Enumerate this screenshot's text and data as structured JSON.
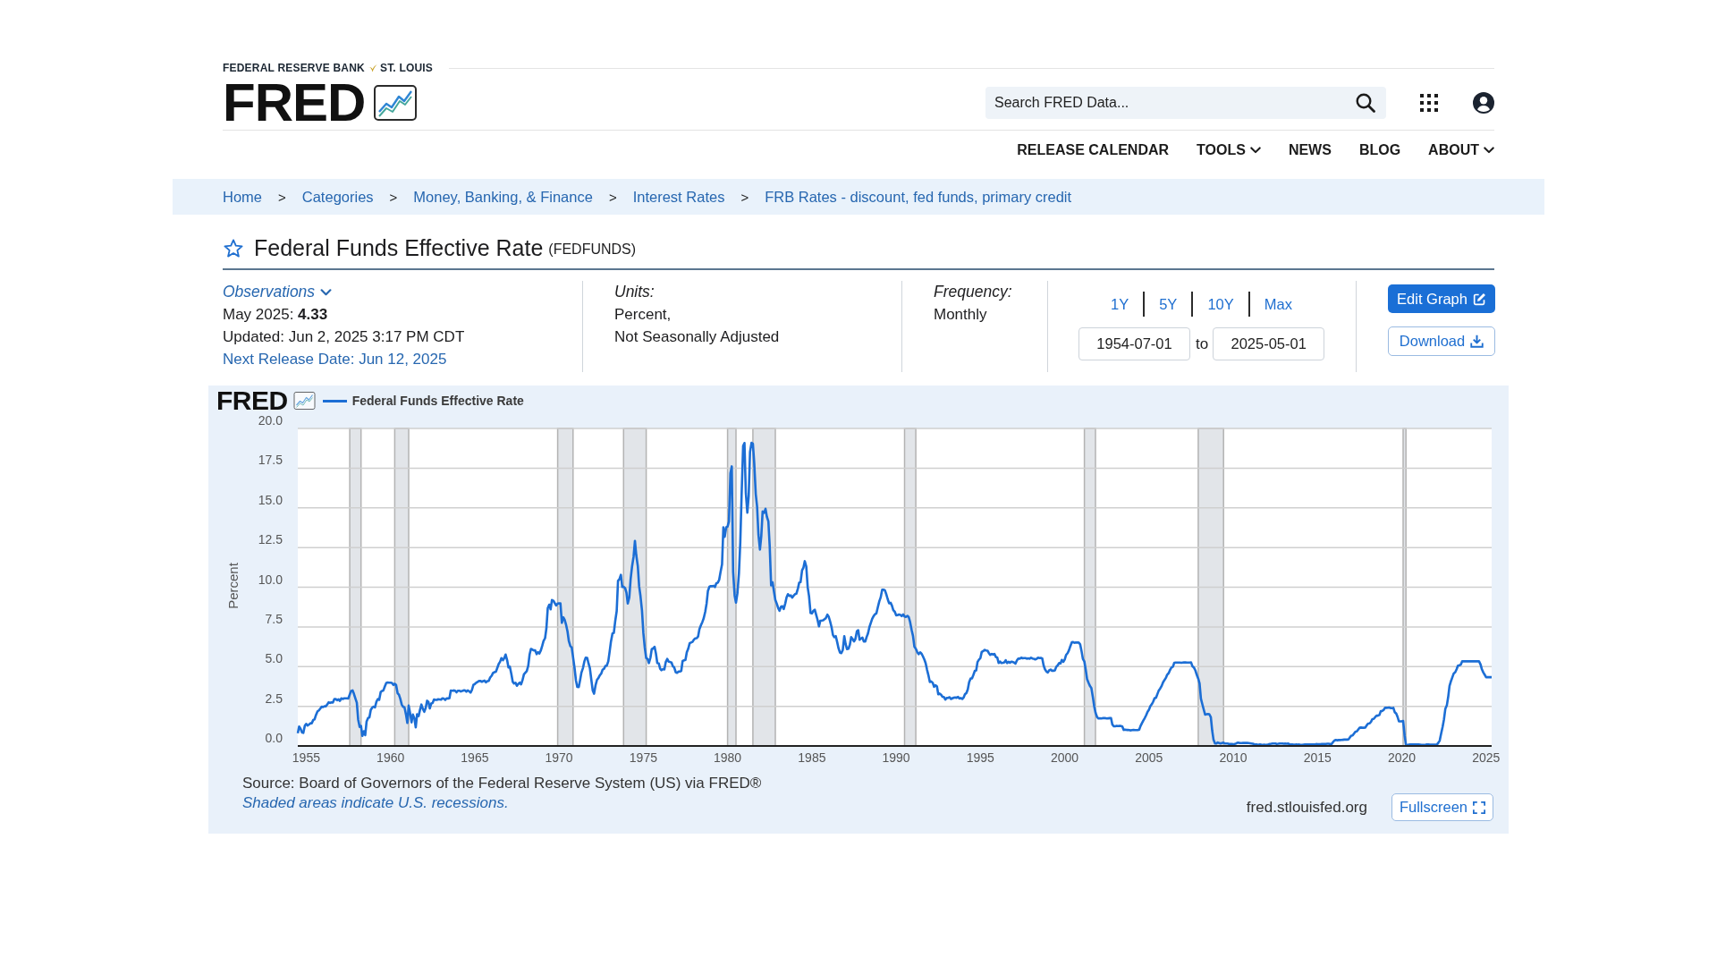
{
  "header": {
    "bank_name": "FEDERAL RESERVE BANK",
    "bank_city": "ST. LOUIS",
    "logo": "FRED",
    "search": {
      "placeholder": "Search FRED Data..."
    }
  },
  "nav": [
    {
      "label": "RELEASE CALENDAR",
      "kind": "link"
    },
    {
      "label": "TOOLS",
      "kind": "menu"
    },
    {
      "label": "NEWS",
      "kind": "link"
    },
    {
      "label": "BLOG",
      "kind": "link"
    },
    {
      "label": "ABOUT",
      "kind": "menu"
    }
  ],
  "breadcrumbs": [
    {
      "kind": "link",
      "text": "Home"
    },
    {
      "kind": "separator",
      "text": ">"
    },
    {
      "kind": "link",
      "text": "Categories"
    },
    {
      "kind": "separator",
      "text": ">"
    },
    {
      "kind": "link",
      "text": "Money, Banking, & Finance"
    },
    {
      "kind": "separator",
      "text": ">"
    },
    {
      "kind": "link",
      "text": "Interest Rates"
    },
    {
      "kind": "separator",
      "text": ">"
    },
    {
      "kind": "link",
      "text": "FRB Rates - discount, fed funds, primary credit"
    }
  ],
  "series": {
    "title": "Federal Funds Effective Rate",
    "code": "(FEDFUNDS)",
    "favorite": false
  },
  "observations": {
    "label": "Observations",
    "latest": "May 2025: **4.33**",
    "updated": "Updated: Jun 2, 2025 3:17 PM CDT",
    "next_release": "Next Release Date: Jun 12, 2025"
  },
  "units": {
    "label": "Units:",
    "lines": [
      "Percent,",
      "Not Seasonally Adjusted"
    ]
  },
  "frequency": {
    "label": "Frequency:",
    "value": "Monthly"
  },
  "date_range": {
    "presets": [
      {
        "label": "1Y",
        "selected": false
      },
      {
        "label": "5Y",
        "selected": false
      },
      {
        "label": "10Y",
        "selected": false
      },
      {
        "label": "Max",
        "selected": false
      }
    ],
    "start": "1954-07-01",
    "separator": "to",
    "end": "2025-05-01"
  },
  "actions": [
    {
      "label": "Edit Graph",
      "kind": "edit"
    },
    {
      "label": "Download",
      "kind": "download"
    }
  ],
  "graph": {
    "logo": "FRED",
    "chart_data": {
      "type": "line",
      "ylabel": "Percent",
      "grid": true,
      "x": [
        1954.5,
        1954.58,
        1954.67,
        1954.75,
        1954.83,
        1954.92,
        1955,
        1955.08,
        1955.17,
        1955.25,
        1955.33,
        1955.42,
        1955.5,
        1955.58,
        1955.67,
        1955.75,
        1955.83,
        1955.92,
        1956,
        1956.08,
        1956.17,
        1956.25,
        1956.33,
        1956.42,
        1956.5,
        1956.58,
        1956.67,
        1956.75,
        1956.83,
        1956.92,
        1957,
        1957.08,
        1957.17,
        1957.25,
        1957.33,
        1957.42,
        1957.5,
        1957.58,
        1957.67,
        1957.75,
        1957.83,
        1957.92,
        1958,
        1958.08,
        1958.17,
        1958.25,
        1958.33,
        1958.42,
        1958.5,
        1958.58,
        1958.67,
        1958.75,
        1958.83,
        1958.92,
        1959,
        1959.08,
        1959.17,
        1959.25,
        1959.33,
        1959.42,
        1959.5,
        1959.58,
        1959.67,
        1959.75,
        1959.83,
        1959.92,
        1960,
        1960.08,
        1960.17,
        1960.25,
        1960.33,
        1960.42,
        1960.5,
        1960.58,
        1960.67,
        1960.75,
        1960.83,
        1960.92,
        1961,
        1961.08,
        1961.17,
        1961.25,
        1961.33,
        1961.42,
        1961.5,
        1961.58,
        1961.67,
        1961.75,
        1961.83,
        1961.92,
        1962,
        1962.08,
        1962.17,
        1962.25,
        1962.33,
        1962.42,
        1962.5,
        1962.58,
        1962.67,
        1962.75,
        1962.83,
        1962.92,
        1963,
        1963.08,
        1963.17,
        1963.25,
        1963.33,
        1963.42,
        1963.5,
        1963.58,
        1963.67,
        1963.75,
        1963.83,
        1963.92,
        1964,
        1964.08,
        1964.17,
        1964.25,
        1964.33,
        1964.42,
        1964.5,
        1964.58,
        1964.67,
        1964.75,
        1964.83,
        1964.92,
        1965,
        1965.08,
        1965.17,
        1965.25,
        1965.33,
        1965.42,
        1965.5,
        1965.58,
        1965.67,
        1965.75,
        1965.83,
        1965.92,
        1966,
        1966.08,
        1966.17,
        1966.25,
        1966.33,
        1966.42,
        1966.5,
        1966.58,
        1966.67,
        1966.75,
        1966.83,
        1966.92,
        1967,
        1967.08,
        1967.17,
        1967.25,
        1967.33,
        1967.42,
        1967.5,
        1967.58,
        1967.67,
        1967.75,
        1967.83,
        1967.92,
        1968,
        1968.08,
        1968.17,
        1968.25,
        1968.33,
        1968.42,
        1968.5,
        1968.58,
        1968.67,
        1968.75,
        1968.83,
        1968.92,
        1969,
        1969.08,
        1969.17,
        1969.25,
        1969.33,
        1969.42,
        1969.5,
        1969.58,
        1969.67,
        1969.75,
        1969.83,
        1969.92,
        1970,
        1970.08,
        1970.17,
        1970.25,
        1970.33,
        1970.42,
        1970.5,
        1970.58,
        1970.67,
        1970.75,
        1970.83,
        1970.92,
        1971,
        1971.08,
        1971.17,
        1971.25,
        1971.33,
        1971.42,
        1971.5,
        1971.58,
        1971.67,
        1971.75,
        1971.83,
        1971.92,
        1972,
        1972.08,
        1972.17,
        1972.25,
        1972.33,
        1972.42,
        1972.5,
        1972.58,
        1972.67,
        1972.75,
        1972.83,
        1972.92,
        1973,
        1973.08,
        1973.17,
        1973.25,
        1973.33,
        1973.42,
        1973.5,
        1973.58,
        1973.67,
        1973.75,
        1973.83,
        1973.92,
        1974,
        1974.08,
        1974.17,
        1974.25,
        1974.33,
        1974.42,
        1974.5,
        1974.58,
        1974.67,
        1974.75,
        1974.83,
        1974.92,
        1975,
        1975.08,
        1975.17,
        1975.25,
        1975.33,
        1975.42,
        1975.5,
        1975.58,
        1975.67,
        1975.75,
        1975.83,
        1975.92,
        1976,
        1976.08,
        1976.17,
        1976.25,
        1976.33,
        1976.42,
        1976.5,
        1976.58,
        1976.67,
        1976.75,
        1976.83,
        1976.92,
        1977,
        1977.08,
        1977.17,
        1977.25,
        1977.33,
        1977.42,
        1977.5,
        1977.58,
        1977.67,
        1977.75,
        1977.83,
        1977.92,
        1978,
        1978.08,
        1978.17,
        1978.25,
        1978.33,
        1978.42,
        1978.5,
        1978.58,
        1978.67,
        1978.75,
        1978.83,
        1978.92,
        1979,
        1979.08,
        1979.17,
        1979.25,
        1979.33,
        1979.42,
        1979.5,
        1979.58,
        1979.67,
        1979.75,
        1979.83,
        1979.92,
        1980,
        1980.08,
        1980.17,
        1980.25,
        1980.33,
        1980.42,
        1980.5,
        1980.58,
        1980.67,
        1980.75,
        1980.83,
        1980.92,
        1981,
        1981.08,
        1981.17,
        1981.25,
        1981.33,
        1981.42,
        1981.5,
        1981.58,
        1981.67,
        1981.75,
        1981.83,
        1981.92,
        1982,
        1982.08,
        1982.17,
        1982.25,
        1982.33,
        1982.42,
        1982.5,
        1982.58,
        1982.67,
        1982.75,
        1982.83,
        1982.92,
        1983,
        1983.08,
        1983.17,
        1983.25,
        1983.33,
        1983.42,
        1983.5,
        1983.58,
        1983.67,
        1983.75,
        1983.83,
        1983.92,
        1984,
        1984.08,
        1984.17,
        1984.25,
        1984.33,
        1984.42,
        1984.5,
        1984.58,
        1984.67,
        1984.75,
        1984.83,
        1984.92,
        1985,
        1985.08,
        1985.17,
        1985.25,
        1985.33,
        1985.42,
        1985.5,
        1985.58,
        1985.67,
        1985.75,
        1985.83,
        1985.92,
        1986,
        1986.08,
        1986.17,
        1986.25,
        1986.33,
        1986.42,
        1986.5,
        1986.58,
        1986.67,
        1986.75,
        1986.83,
        1986.92,
        1987,
        1987.08,
        1987.17,
        1987.25,
        1987.33,
        1987.42,
        1987.5,
        1987.58,
        1987.67,
        1987.75,
        1987.83,
        1987.92,
        1988,
        1988.08,
        1988.17,
        1988.25,
        1988.33,
        1988.42,
        1988.5,
        1988.58,
        1988.67,
        1988.75,
        1988.83,
        1988.92,
        1989,
        1989.08,
        1989.17,
        1989.25,
        1989.33,
        1989.42,
        1989.5,
        1989.58,
        1989.67,
        1989.75,
        1989.83,
        1989.92,
        1990,
        1990.08,
        1990.17,
        1990.25,
        1990.33,
        1990.42,
        1990.5,
        1990.58,
        1990.67,
        1990.75,
        1990.83,
        1990.92,
        1991,
        1991.08,
        1991.17,
        1991.25,
        1991.33,
        1991.42,
        1991.5,
        1991.58,
        1991.67,
        1991.75,
        1991.83,
        1991.92,
        1992,
        1992.08,
        1992.17,
        1992.25,
        1992.33,
        1992.42,
        1992.5,
        1992.58,
        1992.67,
        1992.75,
        1992.83,
        1992.92,
        1993,
        1993.08,
        1993.17,
        1993.25,
        1993.33,
        1993.42,
        1993.5,
        1993.58,
        1993.67,
        1993.75,
        1993.83,
        1993.92,
        1994,
        1994.08,
        1994.17,
        1994.25,
        1994.33,
        1994.42,
        1994.5,
        1994.58,
        1994.67,
        1994.75,
        1994.83,
        1994.92,
        1995,
        1995.08,
        1995.17,
        1995.25,
        1995.33,
        1995.42,
        1995.5,
        1995.58,
        1995.67,
        1995.75,
        1995.83,
        1995.92,
        1996,
        1996.08,
        1996.17,
        1996.25,
        1996.33,
        1996.42,
        1996.5,
        1996.58,
        1996.67,
        1996.75,
        1996.83,
        1996.92,
        1997,
        1997.08,
        1997.17,
        1997.25,
        1997.33,
        1997.42,
        1997.5,
        1997.58,
        1997.67,
        1997.75,
        1997.83,
        1997.92,
        1998,
        1998.08,
        1998.17,
        1998.25,
        1998.33,
        1998.42,
        1998.5,
        1998.58,
        1998.67,
        1998.75,
        1998.83,
        1998.92,
        1999,
        1999.08,
        1999.17,
        1999.25,
        1999.33,
        1999.42,
        1999.5,
        1999.58,
        1999.67,
        1999.75,
        1999.83,
        1999.92,
        2000,
        2000.08,
        2000.17,
        2000.25,
        2000.33,
        2000.42,
        2000.5,
        2000.58,
        2000.67,
        2000.75,
        2000.83,
        2000.92,
        2001,
        2001.08,
        2001.17,
        2001.25,
        2001.33,
        2001.42,
        2001.5,
        2001.58,
        2001.67,
        2001.75,
        2001.83,
        2001.92,
        2002,
        2002.08,
        2002.17,
        2002.25,
        2002.33,
        2002.42,
        2002.5,
        2002.58,
        2002.67,
        2002.75,
        2002.83,
        2002.92,
        2003,
        2003.08,
        2003.17,
        2003.25,
        2003.33,
        2003.42,
        2003.5,
        2003.58,
        2003.67,
        2003.75,
        2003.83,
        2003.92,
        2004,
        2004.08,
        2004.17,
        2004.25,
        2004.33,
        2004.42,
        2004.5,
        2004.58,
        2004.67,
        2004.75,
        2004.83,
        2004.92,
        2005,
        2005.08,
        2005.17,
        2005.25,
        2005.33,
        2005.42,
        2005.5,
        2005.58,
        2005.67,
        2005.75,
        2005.83,
        2005.92,
        2006,
        2006.08,
        2006.17,
        2006.25,
        2006.33,
        2006.42,
        2006.5,
        2006.58,
        2006.67,
        2006.75,
        2006.83,
        2006.92,
        2007,
        2007.08,
        2007.17,
        2007.25,
        2007.33,
        2007.42,
        2007.5,
        2007.58,
        2007.67,
        2007.75,
        2007.83,
        2007.92,
        2008,
        2008.08,
        2008.17,
        2008.25,
        2008.33,
        2008.42,
        2008.5,
        2008.58,
        2008.67,
        2008.75,
        2008.83,
        2008.92,
        2009,
        2009.08,
        2009.17,
        2009.25,
        2009.33,
        2009.42,
        2009.5,
        2009.58,
        2009.67,
        2009.75,
        2009.83,
        2009.92,
        2010,
        2010.08,
        2010.17,
        2010.25,
        2010.33,
        2010.42,
        2010.5,
        2010.58,
        2010.67,
        2010.75,
        2010.83,
        2010.92,
        2011,
        2011.08,
        2011.17,
        2011.25,
        2011.33,
        2011.42,
        2011.5,
        2011.58,
        2011.67,
        2011.75,
        2011.83,
        2011.92,
        2012,
        2012.08,
        2012.17,
        2012.25,
        2012.33,
        2012.42,
        2012.5,
        2012.58,
        2012.67,
        2012.75,
        2012.83,
        2012.92,
        2013,
        2013.08,
        2013.17,
        2013.25,
        2013.33,
        2013.42,
        2013.5,
        2013.58,
        2013.67,
        2013.75,
        2013.83,
        2013.92,
        2014,
        2014.08,
        2014.17,
        2014.25,
        2014.33,
        2014.42,
        2014.5,
        2014.58,
        2014.67,
        2014.75,
        2014.83,
        2014.92,
        2015,
        2015.08,
        2015.17,
        2015.25,
        2015.33,
        2015.42,
        2015.5,
        2015.58,
        2015.67,
        2015.75,
        2015.83,
        2015.92,
        2016,
        2016.08,
        2016.17,
        2016.25,
        2016.33,
        2016.42,
        2016.5,
        2016.58,
        2016.67,
        2016.75,
        2016.83,
        2016.92,
        2017,
        2017.08,
        2017.17,
        2017.25,
        2017.33,
        2017.42,
        2017.5,
        2017.58,
        2017.67,
        2017.75,
        2017.83,
        2017.92,
        2018,
        2018.08,
        2018.17,
        2018.25,
        2018.33,
        2018.42,
        2018.5,
        2018.58,
        2018.67,
        2018.75,
        2018.83,
        2018.92,
        2019,
        2019.08,
        2019.17,
        2019.25,
        2019.33,
        2019.42,
        2019.5,
        2019.58,
        2019.67,
        2019.75,
        2019.83,
        2019.92,
        2020,
        2020.08,
        2020.17,
        2020.25,
        2020.33,
        2020.42,
        2020.5,
        2020.58,
        2020.67,
        2020.75,
        2020.83,
        2020.92,
        2021,
        2021.08,
        2021.17,
        2021.25,
        2021.33,
        2021.42,
        2021.5,
        2021.58,
        2021.67,
        2021.75,
        2021.83,
        2021.92,
        2022,
        2022.08,
        2022.17,
        2022.25,
        2022.33,
        2022.42,
        2022.5,
        2022.58,
        2022.67,
        2022.75,
        2022.83,
        2022.92,
        2023,
        2023.08,
        2023.17,
        2023.25,
        2023.33,
        2023.42,
        2023.5,
        2023.58,
        2023.67,
        2023.75,
        2023.83,
        2023.92,
        2024,
        2024.08,
        2024.17,
        2024.25,
        2024.33,
        2024.42,
        2024.5,
        2024.58,
        2024.67,
        2024.75,
        2024.83,
        2024.92,
        2025,
        2025.08,
        2025.17,
        2025.25,
        2025.33
      ],
      "series": [
        {
          "name": "Federal Funds Effective Rate",
          "color": "#1c6ed5",
          "values": [
            0.8,
            1.22,
            1.07,
            0.85,
            0.83,
            1.28,
            1.39,
            1.29,
            1.35,
            1.43,
            1.43,
            1.64,
            1.68,
            1.96,
            2.18,
            2.24,
            2.35,
            2.48,
            2.45,
            2.5,
            2.5,
            2.62,
            2.75,
            2.71,
            2.75,
            2.73,
            2.95,
            2.96,
            2.88,
            2.94,
            2.84,
            3.0,
            2.96,
            3.0,
            3.0,
            3.0,
            2.99,
            3.24,
            3.47,
            3.5,
            3.28,
            2.98,
            2.72,
            1.67,
            1.2,
            1.26,
            0.63,
            0.93,
            0.68,
            1.53,
            1.76,
            1.8,
            2.27,
            2.42,
            2.48,
            2.43,
            2.8,
            2.96,
            2.9,
            3.39,
            3.47,
            3.5,
            3.76,
            3.98,
            4.0,
            3.99,
            3.99,
            3.97,
            3.84,
            3.92,
            3.85,
            3.32,
            3.23,
            2.98,
            2.6,
            2.47,
            2.44,
            1.98,
            1.45,
            2.54,
            2.02,
            1.49,
            1.98,
            1.73,
            1.17,
            2.0,
            1.88,
            2.26,
            2.61,
            2.33,
            2.15,
            2.37,
            2.85,
            2.78,
            2.36,
            2.68,
            2.71,
            2.93,
            2.9,
            2.9,
            2.94,
            2.93,
            2.92,
            3.0,
            2.98,
            2.9,
            3.0,
            2.99,
            3.02,
            3.49,
            3.48,
            3.5,
            3.48,
            3.38,
            3.48,
            3.48,
            3.43,
            3.47,
            3.5,
            3.5,
            3.42,
            3.5,
            3.45,
            3.36,
            3.52,
            3.85,
            3.9,
            3.98,
            4.04,
            4.09,
            4.1,
            4.04,
            4.09,
            4.12,
            4.01,
            4.08,
            4.1,
            4.32,
            4.42,
            4.6,
            4.65,
            4.67,
            4.9,
            5.17,
            5.3,
            5.53,
            5.4,
            5.53,
            5.76,
            5.4,
            4.94,
            5.0,
            4.53,
            4.05,
            3.94,
            3.98,
            3.79,
            3.9,
            3.99,
            3.88,
            4.13,
            4.51,
            4.61,
            4.71,
            5.05,
            5.76,
            6.11,
            6.07,
            6.02,
            6.03,
            5.78,
            5.91,
            5.82,
            6.02,
            6.3,
            6.61,
            6.79,
            7.41,
            8.67,
            8.9,
            8.61,
            9.19,
            9.15,
            9.0,
            8.85,
            8.97,
            8.98,
            8.98,
            7.76,
            8.1,
            7.95,
            7.61,
            7.21,
            6.61,
            6.29,
            6.2,
            5.6,
            4.9,
            4.14,
            3.72,
            3.71,
            4.16,
            4.63,
            4.91,
            5.31,
            5.56,
            5.55,
            5.2,
            4.91,
            4.14,
            3.5,
            3.29,
            3.83,
            4.17,
            4.27,
            4.46,
            4.55,
            4.8,
            4.87,
            5.04,
            5.06,
            5.33,
            5.94,
            6.58,
            7.09,
            7.12,
            7.84,
            8.49,
            10.4,
            10.5,
            10.78,
            10.01,
            10.03,
            9.95,
            9.65,
            8.97,
            9.35,
            10.51,
            11.31,
            11.93,
            12.92,
            12.01,
            11.34,
            10.06,
            9.45,
            8.53,
            7.13,
            6.24,
            5.54,
            5.49,
            5.22,
            5.55,
            6.1,
            6.14,
            6.24,
            5.82,
            5.22,
            5.2,
            4.87,
            4.77,
            4.84,
            4.82,
            5.29,
            5.48,
            5.31,
            5.29,
            5.25,
            5.02,
            4.95,
            4.65,
            4.61,
            4.68,
            4.69,
            4.73,
            5.35,
            5.39,
            5.42,
            5.9,
            6.14,
            6.47,
            6.51,
            6.56,
            6.7,
            6.78,
            6.79,
            6.89,
            7.36,
            7.6,
            7.81,
            8.04,
            8.45,
            8.96,
            9.76,
            10.03,
            10.07,
            10.06,
            10.09,
            10.01,
            10.24,
            10.29,
            10.47,
            10.94,
            11.43,
            13.77,
            13.18,
            13.78,
            13.82,
            14.13,
            17.19,
            17.61,
            10.98,
            9.47,
            9.03,
            9.61,
            10.87,
            12.81,
            15.85,
            18.9,
            19.08,
            15.93,
            14.7,
            15.72,
            18.52,
            19.1,
            19.04,
            17.82,
            15.87,
            15.08,
            13.31,
            12.37,
            13.22,
            14.78,
            14.68,
            14.94,
            14.45,
            14.15,
            12.59,
            10.12,
            10.31,
            9.71,
            9.2,
            8.95,
            8.68,
            8.51,
            8.77,
            8.8,
            8.63,
            8.98,
            9.37,
            9.56,
            9.45,
            9.48,
            9.34,
            9.47,
            9.56,
            9.59,
            9.91,
            10.29,
            10.32,
            11.06,
            11.23,
            11.64,
            11.3,
            9.99,
            9.43,
            8.38,
            8.35,
            8.5,
            8.58,
            8.27,
            7.97,
            7.53,
            7.88,
            7.9,
            7.92,
            7.99,
            8.05,
            8.27,
            8.14,
            7.86,
            7.48,
            6.99,
            6.85,
            6.92,
            6.56,
            6.17,
            5.89,
            5.85,
            6.04,
            6.91,
            6.43,
            6.1,
            6.13,
            6.37,
            6.85,
            6.73,
            6.58,
            6.73,
            7.22,
            7.29,
            6.69,
            6.77,
            6.83,
            6.58,
            6.58,
            6.87,
            7.09,
            7.51,
            7.75,
            8.01,
            8.19,
            8.3,
            8.35,
            8.76,
            9.12,
            9.36,
            9.85,
            9.84,
            9.81,
            9.53,
            9.24,
            8.99,
            9.02,
            8.84,
            8.55,
            8.45,
            8.23,
            8.24,
            8.28,
            8.26,
            8.18,
            8.29,
            8.15,
            8.13,
            8.2,
            8.11,
            7.81,
            7.31,
            6.91,
            6.25,
            6.12,
            5.91,
            5.78,
            5.9,
            5.82,
            5.66,
            5.45,
            5.21,
            4.81,
            4.43,
            4.03,
            4.06,
            3.98,
            3.73,
            3.82,
            3.76,
            3.25,
            3.3,
            3.22,
            3.1,
            3.09,
            2.92,
            3.02,
            3.03,
            3.07,
            2.96,
            3.0,
            3.04,
            3.06,
            3.03,
            3.09,
            2.99,
            3.02,
            2.96,
            3.05,
            3.25,
            3.34,
            3.56,
            4.01,
            4.25,
            4.26,
            4.47,
            4.73,
            4.76,
            5.29,
            5.45,
            5.53,
            5.92,
            5.98,
            6.05,
            6.01,
            6.0,
            5.85,
            5.74,
            5.8,
            5.76,
            5.8,
            5.6,
            5.56,
            5.22,
            5.31,
            5.22,
            5.24,
            5.27,
            5.4,
            5.22,
            5.3,
            5.24,
            5.31,
            5.29,
            5.25,
            5.19,
            5.39,
            5.51,
            5.5,
            5.56,
            5.52,
            5.54,
            5.54,
            5.5,
            5.52,
            5.5,
            5.56,
            5.51,
            5.49,
            5.45,
            5.49,
            5.56,
            5.54,
            5.55,
            5.51,
            5.07,
            4.83,
            4.68,
            4.63,
            4.76,
            4.81,
            4.74,
            4.74,
            4.76,
            4.99,
            5.07,
            5.22,
            5.2,
            5.42,
            5.3,
            5.45,
            5.73,
            5.85,
            6.02,
            6.27,
            6.53,
            6.54,
            6.5,
            6.52,
            6.51,
            6.51,
            6.4,
            5.98,
            5.49,
            5.31,
            4.8,
            4.21,
            3.97,
            3.77,
            3.65,
            3.07,
            2.49,
            2.09,
            1.82,
            1.73,
            1.74,
            1.73,
            1.75,
            1.75,
            1.75,
            1.73,
            1.74,
            1.75,
            1.75,
            1.34,
            1.24,
            1.24,
            1.26,
            1.25,
            1.26,
            1.26,
            1.22,
            1.01,
            1.03,
            1.01,
            1.01,
            1.0,
            0.98,
            1.0,
            1.01,
            1.0,
            1.0,
            1.0,
            1.03,
            1.26,
            1.43,
            1.61,
            1.76,
            1.93,
            2.16,
            2.28,
            2.5,
            2.63,
            2.79,
            3.0,
            3.04,
            3.26,
            3.5,
            3.62,
            3.78,
            4.0,
            4.16,
            4.29,
            4.49,
            4.59,
            4.79,
            4.94,
            4.99,
            5.24,
            5.25,
            5.25,
            5.25,
            5.25,
            5.24,
            5.25,
            5.26,
            5.26,
            5.25,
            5.25,
            5.25,
            5.26,
            5.02,
            4.94,
            4.76,
            4.49,
            4.24,
            3.94,
            2.98,
            2.61,
            2.28,
            1.98,
            2.0,
            2.01,
            2.0,
            1.81,
            0.97,
            0.39,
            0.16,
            0.15,
            0.22,
            0.18,
            0.15,
            0.18,
            0.21,
            0.16,
            0.16,
            0.15,
            0.12,
            0.12,
            0.12,
            0.11,
            0.13,
            0.16,
            0.2,
            0.2,
            0.18,
            0.18,
            0.19,
            0.19,
            0.19,
            0.19,
            0.18,
            0.17,
            0.16,
            0.14,
            0.1,
            0.09,
            0.09,
            0.07,
            0.1,
            0.08,
            0.07,
            0.08,
            0.07,
            0.08,
            0.1,
            0.13,
            0.14,
            0.16,
            0.16,
            0.16,
            0.13,
            0.14,
            0.16,
            0.16,
            0.16,
            0.14,
            0.15,
            0.14,
            0.15,
            0.11,
            0.09,
            0.09,
            0.08,
            0.08,
            0.09,
            0.08,
            0.09,
            0.07,
            0.07,
            0.08,
            0.09,
            0.09,
            0.1,
            0.09,
            0.09,
            0.09,
            0.09,
            0.09,
            0.12,
            0.11,
            0.11,
            0.11,
            0.12,
            0.12,
            0.13,
            0.13,
            0.14,
            0.14,
            0.12,
            0.12,
            0.24,
            0.34,
            0.38,
            0.36,
            0.37,
            0.37,
            0.38,
            0.39,
            0.4,
            0.4,
            0.4,
            0.41,
            0.54,
            0.65,
            0.66,
            0.79,
            0.9,
            0.91,
            1.04,
            1.15,
            1.16,
            1.15,
            1.15,
            1.16,
            1.3,
            1.41,
            1.42,
            1.51,
            1.69,
            1.7,
            1.82,
            1.91,
            1.91,
            1.95,
            2.19,
            2.2,
            2.27,
            2.4,
            2.4,
            2.41,
            2.42,
            2.39,
            2.38,
            2.4,
            2.13,
            2.04,
            1.83,
            1.55,
            1.55,
            1.55,
            1.58,
            0.65,
            0.05,
            0.05,
            0.08,
            0.09,
            0.1,
            0.09,
            0.09,
            0.09,
            0.09,
            0.09,
            0.08,
            0.07,
            0.07,
            0.06,
            0.08,
            0.1,
            0.09,
            0.08,
            0.08,
            0.08,
            0.08,
            0.08,
            0.08,
            0.2,
            0.33,
            0.77,
            1.21,
            1.68,
            2.33,
            2.56,
            3.08,
            3.78,
            4.1,
            4.33,
            4.57,
            4.65,
            4.83,
            5.06,
            5.08,
            5.12,
            5.33,
            5.33,
            5.33,
            5.33,
            5.33,
            5.33,
            5.33,
            5.33,
            5.33,
            5.33,
            5.33,
            5.33,
            5.33,
            5.13,
            4.83,
            4.64,
            4.48,
            4.33,
            4.33,
            4.33,
            4.33,
            4.33
          ]
        }
      ],
      "xlim": [
        1954.5,
        2025.33
      ],
      "ylim": [
        0,
        20
      ],
      "yticks": [
        {
          "value": 0,
          "label": "0.0"
        },
        {
          "value": 2.5,
          "label": "2.5"
        },
        {
          "value": 5,
          "label": "5.0"
        },
        {
          "value": 7.5,
          "label": "7.5"
        },
        {
          "value": 10,
          "label": "10.0"
        },
        {
          "value": 12.5,
          "label": "12.5"
        },
        {
          "value": 15,
          "label": "15.0"
        },
        {
          "value": 17.5,
          "label": "17.5"
        },
        {
          "value": 20,
          "label": "20.0"
        }
      ],
      "xticks": [
        1955,
        1960,
        1965,
        1970,
        1975,
        1980,
        1985,
        1990,
        1995,
        2000,
        2005,
        2010,
        2015,
        2020,
        2025
      ],
      "bands": [
        {
          "axis": "x",
          "from": 1957.58,
          "to": 1958.25
        },
        {
          "axis": "x",
          "from": 1960.25,
          "to": 1961.08
        },
        {
          "axis": "x",
          "from": 1969.92,
          "to": 1970.83
        },
        {
          "axis": "x",
          "from": 1973.83,
          "to": 1975.17
        },
        {
          "axis": "x",
          "from": 1980,
          "to": 1980.5
        },
        {
          "axis": "x",
          "from": 1981.5,
          "to": 1982.83
        },
        {
          "axis": "x",
          "from": 1990.5,
          "to": 1991.17
        },
        {
          "axis": "x",
          "from": 2001.17,
          "to": 2001.83
        },
        {
          "axis": "x",
          "from": 2007.92,
          "to": 2009.42
        },
        {
          "axis": "x",
          "from": 2020.08,
          "to": 2020.25
        }
      ]
    },
    "source": "Source: Board of Governors of the Federal Reserve System (US) via FRED®",
    "note": "Shaded areas indicate U.S. recessions.",
    "site": "fred.stlouisfed.org",
    "fullscreen": "Fullscreen"
  }
}
